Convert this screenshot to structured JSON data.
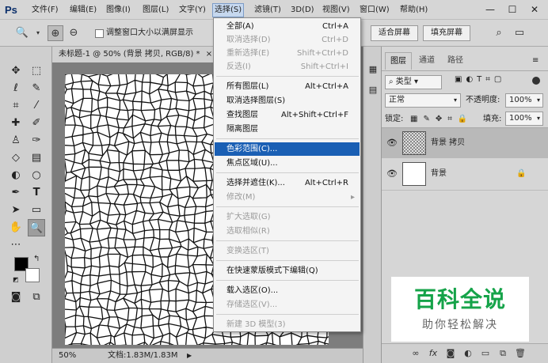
{
  "app": {
    "logo": "Ps"
  },
  "menubar": {
    "items": [
      "文件(F)",
      "编辑(E)",
      "图像(I)",
      "图层(L)",
      "文字(Y)",
      "选择(S)",
      "滤镜(T)",
      "3D(D)",
      "视图(V)",
      "窗口(W)",
      "帮助(H)"
    ],
    "active_index": 5
  },
  "window_controls": {
    "minimize": "—",
    "maximize": "☐",
    "close": "✕"
  },
  "options_bar": {
    "checkbox_label": "调整窗口大小以满屏显示",
    "fit_screen": "适合屏幕",
    "fill_screen": "填充屏幕"
  },
  "document": {
    "tab_title": "未标题-1 @ 50% (背景 拷贝, RGB/8) *",
    "tab_close": "×",
    "zoom": "50%",
    "doc_info": "文档:1.83M/1.83M",
    "status_arrow": "▶"
  },
  "select_menu": {
    "items": [
      {
        "label": "全部(A)",
        "shortcut": "Ctrl+A",
        "disabled": false
      },
      {
        "label": "取消选择(D)",
        "shortcut": "Ctrl+D",
        "disabled": true
      },
      {
        "label": "重新选择(E)",
        "shortcut": "Shift+Ctrl+D",
        "disabled": true
      },
      {
        "label": "反选(I)",
        "shortcut": "Shift+Ctrl+I",
        "disabled": true
      },
      {
        "label": "所有图层(L)",
        "shortcut": "Alt+Ctrl+A",
        "disabled": false
      },
      {
        "label": "取消选择图层(S)",
        "shortcut": "",
        "disabled": false
      },
      {
        "label": "查找图层",
        "shortcut": "Alt+Shift+Ctrl+F",
        "disabled": false
      },
      {
        "label": "隔离图层",
        "shortcut": "",
        "disabled": false
      },
      {
        "label": "色彩范围(C)...",
        "shortcut": "",
        "disabled": false,
        "highlighted": true
      },
      {
        "label": "焦点区域(U)...",
        "shortcut": "",
        "disabled": false
      },
      {
        "label": "选择并遮住(K)...",
        "shortcut": "Alt+Ctrl+R",
        "disabled": false
      },
      {
        "label": "修改(M)",
        "shortcut": "",
        "disabled": true,
        "submenu": true
      },
      {
        "label": "扩大选取(G)",
        "shortcut": "",
        "disabled": true
      },
      {
        "label": "选取相似(R)",
        "shortcut": "",
        "disabled": true
      },
      {
        "label": "变换选区(T)",
        "shortcut": "",
        "disabled": true
      },
      {
        "label": "在快速蒙版模式下编辑(Q)",
        "shortcut": "",
        "disabled": false
      },
      {
        "label": "载入选区(O)...",
        "shortcut": "",
        "disabled": false
      },
      {
        "label": "存储选区(V)...",
        "shortcut": "",
        "disabled": true
      },
      {
        "label": "新建 3D 模型(3)",
        "shortcut": "",
        "disabled": true
      }
    ]
  },
  "layers_panel": {
    "tabs": [
      "图层",
      "通道",
      "路径"
    ],
    "active_tab": 0,
    "filter_kind": "类型",
    "blend_mode": "正常",
    "opacity_label": "不透明度:",
    "opacity_value": "100%",
    "lock_label": "锁定:",
    "fill_label": "填充:",
    "fill_value": "100%",
    "layers": [
      {
        "name": "背景 拷贝",
        "visible": true,
        "selected": true,
        "locked": false
      },
      {
        "name": "背景",
        "visible": true,
        "selected": false,
        "locked": true
      }
    ]
  },
  "watermark": {
    "title": "百科全说",
    "subtitle": "助你轻松解决"
  },
  "colors": {
    "accent": "#1a5fb4",
    "watermark_green": "#15a349"
  }
}
